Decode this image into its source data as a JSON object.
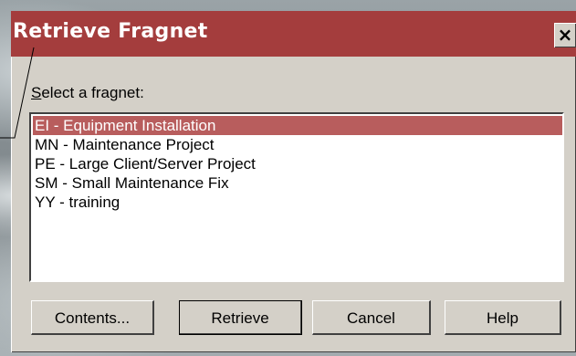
{
  "dialog": {
    "title": "Retrieve Fragnet",
    "close_glyph": "×",
    "prompt_hotkey": "S",
    "prompt_rest": "elect a fragnet:"
  },
  "fragnets": [
    {
      "label": "EI - Equipment Installation",
      "selected": true
    },
    {
      "label": "MN - Maintenance Project",
      "selected": false
    },
    {
      "label": "PE - Large Client/Server Project",
      "selected": false
    },
    {
      "label": "SM - Small Maintenance Fix",
      "selected": false
    },
    {
      "label": "YY - training",
      "selected": false
    }
  ],
  "buttons": {
    "contents": "Contents...",
    "retrieve": "Retrieve",
    "cancel": "Cancel",
    "help": "Help"
  },
  "colors": {
    "titlebar": "#a43d3d",
    "selection": "#b85d5d",
    "face": "#d4d0c8"
  }
}
